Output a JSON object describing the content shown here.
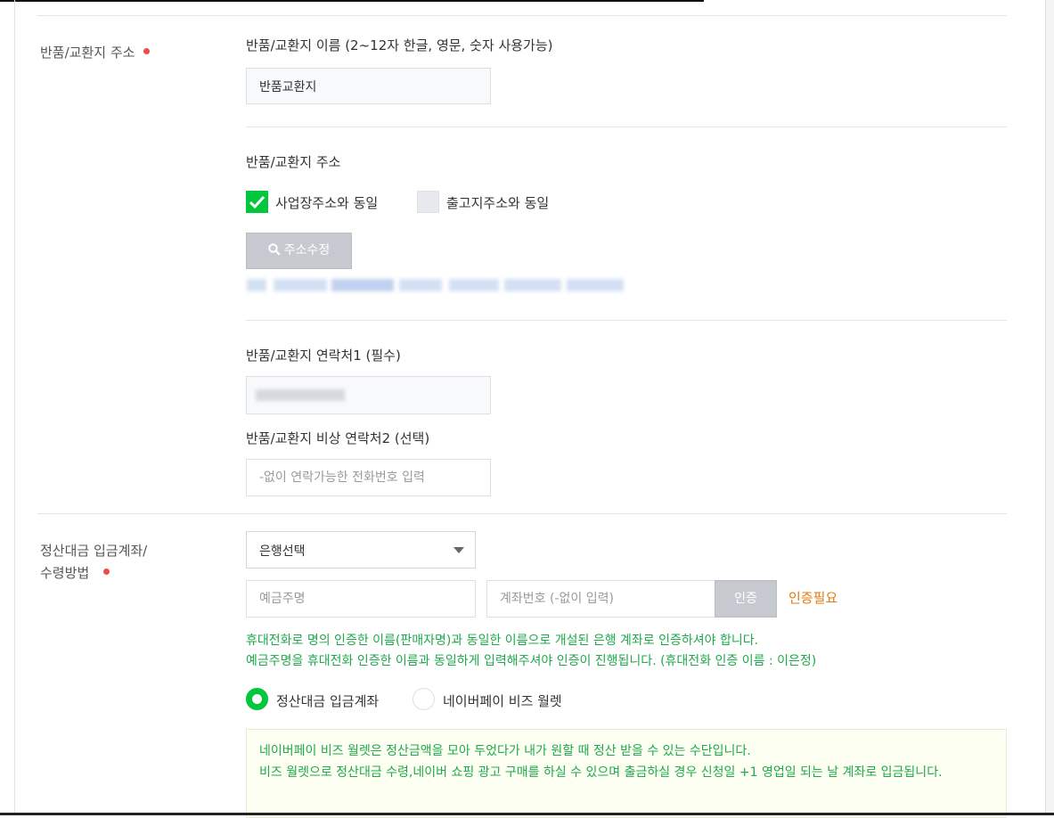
{
  "return_address_section": {
    "label": "반품/교환지 주소",
    "name_title": "반품/교환지 이름 (2~12자 한글, 영문, 숫자 사용가능)",
    "name_value": "반품교환지",
    "address_title": "반품/교환지 주소",
    "same_as_business": "사업장주소와 동일",
    "same_as_shipping": "출고지주소와 동일",
    "edit_address_button": "주소수정",
    "contact1_title": "반품/교환지 연락처1 (필수)",
    "contact2_title": "반품/교환지 비상 연락처2 (선택)",
    "contact2_placeholder": "-없이 연락가능한 전화번호 입력"
  },
  "settlement_section": {
    "label_line1": "정산대금 입금계좌/",
    "label_line2": "수령방법",
    "bank_select": "은행선택",
    "account_holder_placeholder": "예금주명",
    "account_number_placeholder": "계좌번호 (-없이 입력)",
    "verify_button": "인증",
    "verify_status": "인증필요",
    "help_line1": "휴대전화로 명의 인증한 이름(판매자명)과 동일한 이름으로 개설된 은행 계좌로 인증하셔야 합니다.",
    "help_line2": "예금주명을 휴대전화 인증한 이름과 동일하게 입력해주셔야 인증이 진행됩니다. (휴대전화 인증 이름 : 이은정)",
    "radio_account": "정산대금 입금계좌",
    "radio_wallet": "네이버페이 비즈 월렛",
    "notice_line1": "네이버페이 비즈 월렛은 정산금액을 모아 두었다가 내가 원할 때 정산 받을 수 있는 수단입니다.",
    "notice_line2": "비즈 월렛으로 정산대금 수령,네이버 쇼핑 광고 구매를 하실 수 있으며 출금하실 경우 신청일 +1 영업일 되는 날 계좌로 입금됩니다."
  },
  "colors": {
    "accent_green": "#00c73c",
    "required_dot": "#f04b4b",
    "warning_orange": "#e07b12",
    "help_green": "#1fa84b"
  }
}
